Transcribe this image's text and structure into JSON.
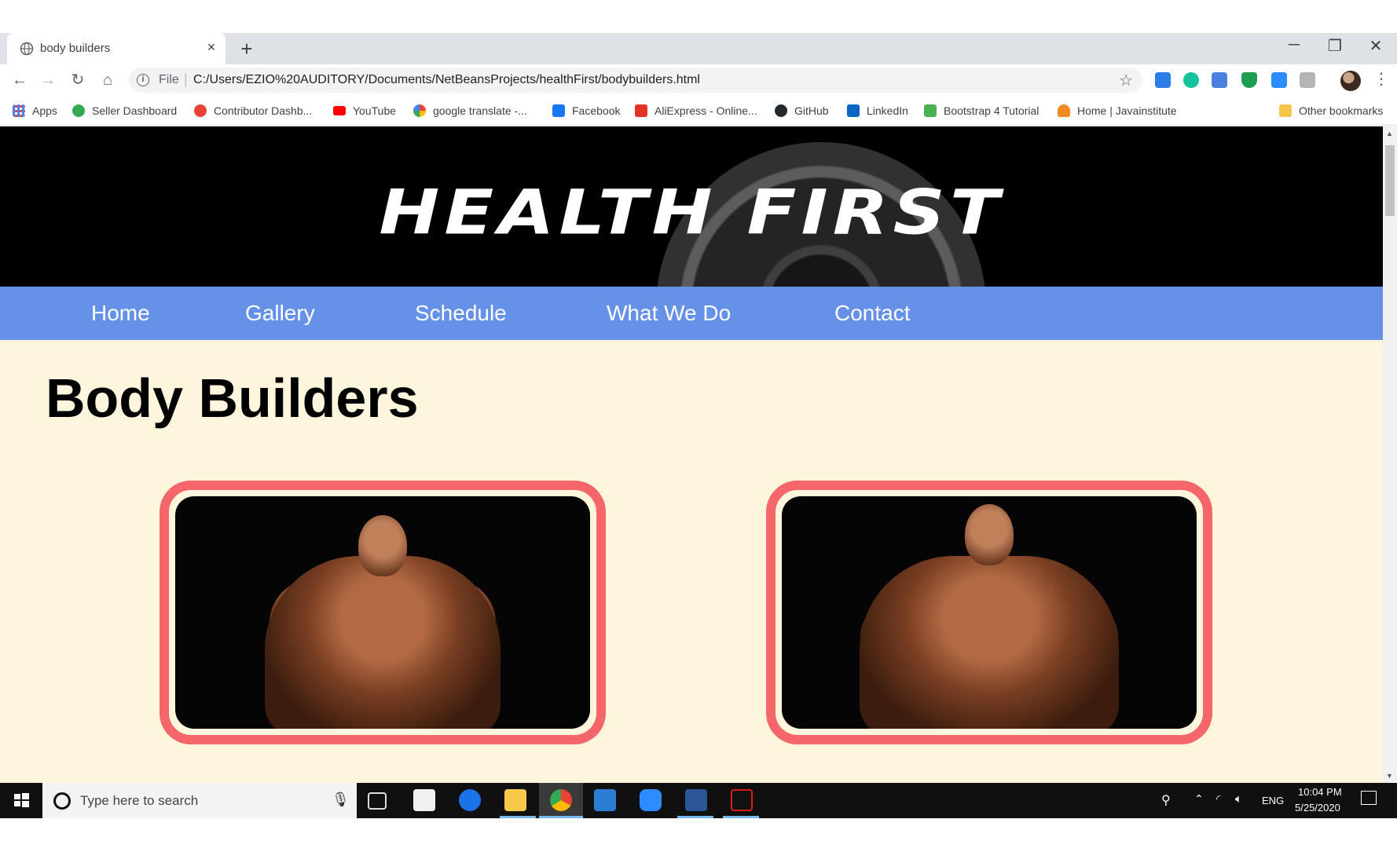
{
  "browser": {
    "tab_title": "body builders",
    "tab_close": "×",
    "new_tab": "+",
    "window_controls": {
      "minimize": "─",
      "restore": "❐",
      "close": "✕"
    },
    "nav": {
      "back": "←",
      "forward": "→",
      "reload": "↻",
      "home": "⌂"
    },
    "omnibox": {
      "info": "i",
      "scheme": "File",
      "separator": "|",
      "url": "C:/Users/EZIO%20AUDITORY/Documents/NetBeansProjects/healthFirst/bodybuilders.html",
      "star": "☆"
    },
    "menu": "⋮"
  },
  "bookmarks": [
    {
      "label": "Apps",
      "color": "#4285f4"
    },
    {
      "label": "Seller Dashboard",
      "color": "#34a853"
    },
    {
      "label": "Contributor Dashb...",
      "color": "#ea4335"
    },
    {
      "label": "YouTube",
      "color": "#ff0000"
    },
    {
      "label": "google translate -...",
      "color": "#4285f4"
    },
    {
      "label": "Facebook",
      "color": "#1877f2"
    },
    {
      "label": "AliExpress - Online...",
      "color": "#e43225"
    },
    {
      "label": "GitHub",
      "color": "#24292e"
    },
    {
      "label": "LinkedIn",
      "color": "#0a66c2"
    },
    {
      "label": "Bootstrap 4 Tutorial",
      "color": "#4caf50"
    },
    {
      "label": "Home | Javainstitute",
      "color": "#f08a24"
    },
    {
      "label": "Other bookmarks",
      "color": "#f6c64a"
    }
  ],
  "page": {
    "logo_text": "HEALTH FIRST",
    "nav": [
      "Home",
      "Gallery",
      "Schedule",
      "What We Do",
      "Contact"
    ],
    "heading": "Body Builders",
    "colors": {
      "background": "#fdf5dc",
      "nav": "#6592e8",
      "card_border": "#f4666a"
    }
  },
  "taskbar": {
    "search_placeholder": "Type here to search",
    "mic": "🎙",
    "language": "ENG",
    "time": "10:04 PM",
    "date": "5/25/2020",
    "tray_icons": [
      "people-icon",
      "chevron-up-icon",
      "wifi-icon",
      "volume-icon",
      "notification-icon"
    ]
  }
}
